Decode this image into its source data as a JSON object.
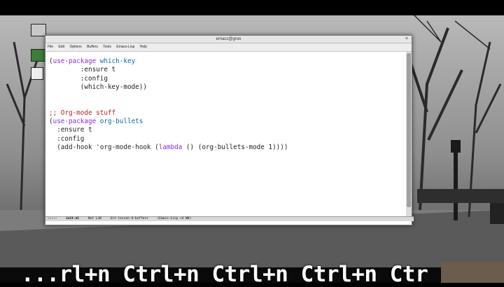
{
  "window": {
    "title": "emacs@groo"
  },
  "menu": [
    "File",
    "Edit",
    "Options",
    "Buffers",
    "Tools",
    "Emacs-Lisp",
    "Help"
  ],
  "editor": {
    "lines": [
      [
        {
          "t": "(",
          "c": ""
        },
        {
          "t": "use-package",
          "c": "kw"
        },
        {
          "t": " ",
          "c": ""
        },
        {
          "t": "which-key",
          "c": "fn"
        }
      ],
      [
        {
          "t": "        :ensure t",
          "c": ""
        }
      ],
      [
        {
          "t": "        :config",
          "c": ""
        }
      ],
      [
        {
          "t": "        (which-key-mode))",
          "c": ""
        }
      ],
      [],
      [],
      [
        {
          "t": ";; Org-mode stuff",
          "c": "cm"
        }
      ],
      [
        {
          "t": "(",
          "c": ""
        },
        {
          "t": "use-package",
          "c": "kw"
        },
        {
          "t": " ",
          "c": ""
        },
        {
          "t": "org-bullets",
          "c": "fn"
        }
      ],
      [
        {
          "t": "  :ensure t",
          "c": ""
        }
      ],
      [
        {
          "t": "  :config",
          "c": ""
        }
      ],
      [
        {
          "t": "  (add-hook 'org-mode-hook (",
          "c": ""
        },
        {
          "t": "lambda",
          "c": "lam"
        },
        {
          "t": " () (org-bullets-mode 1))))",
          "c": ""
        }
      ]
    ]
  },
  "modeline": {
    "status": "-:---",
    "buffer": "init.el",
    "position": "Bot L30",
    "branch": "Git-lesson-4-buffers",
    "mode": "(Emacs-Lisp +4 WK)"
  },
  "caption": "...rl+n Ctrl+n Ctrl+n Ctrl+n Ctr"
}
